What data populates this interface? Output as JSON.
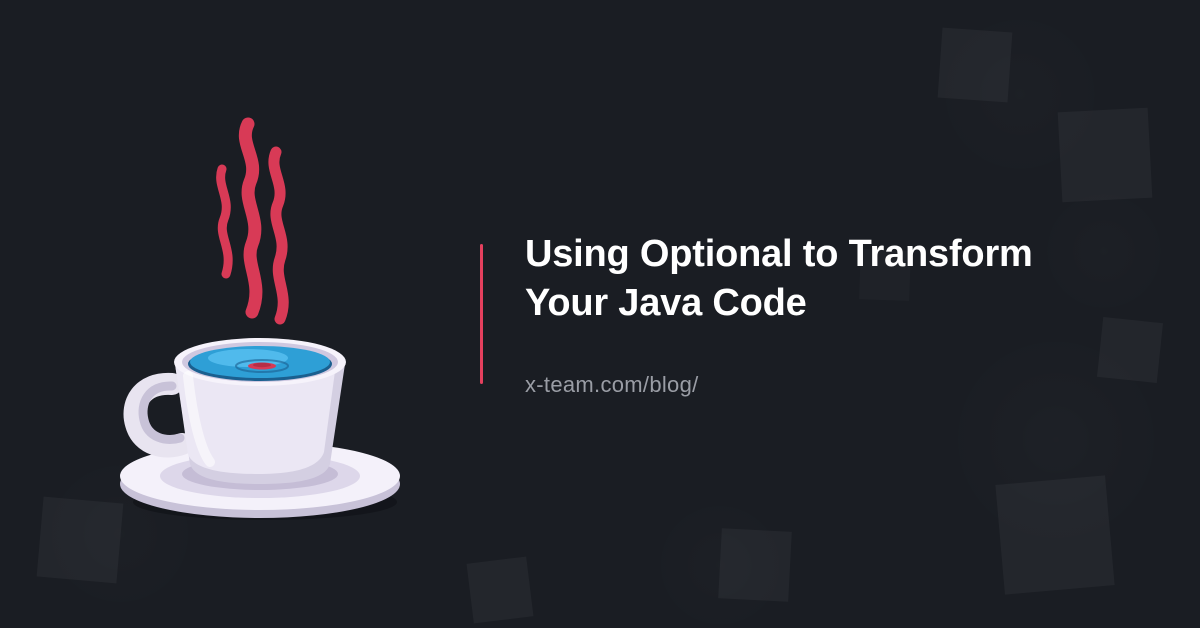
{
  "title": "Using Optional to Transform Your Java Code",
  "subtitle": "x-team.com/blog/",
  "colors": {
    "background": "#1a1d23",
    "accent": "#e5405e",
    "text_primary": "#ffffff",
    "text_secondary": "#9a9da5",
    "coffee_liquid": "#2e9fd6",
    "steam": "#d83a56",
    "cup": "#e8e4f0",
    "saucer": "#f0edf7"
  },
  "illustration": {
    "name": "java-coffee-cup-icon",
    "description": "coffee cup with steam on saucer (Java logo style)"
  }
}
